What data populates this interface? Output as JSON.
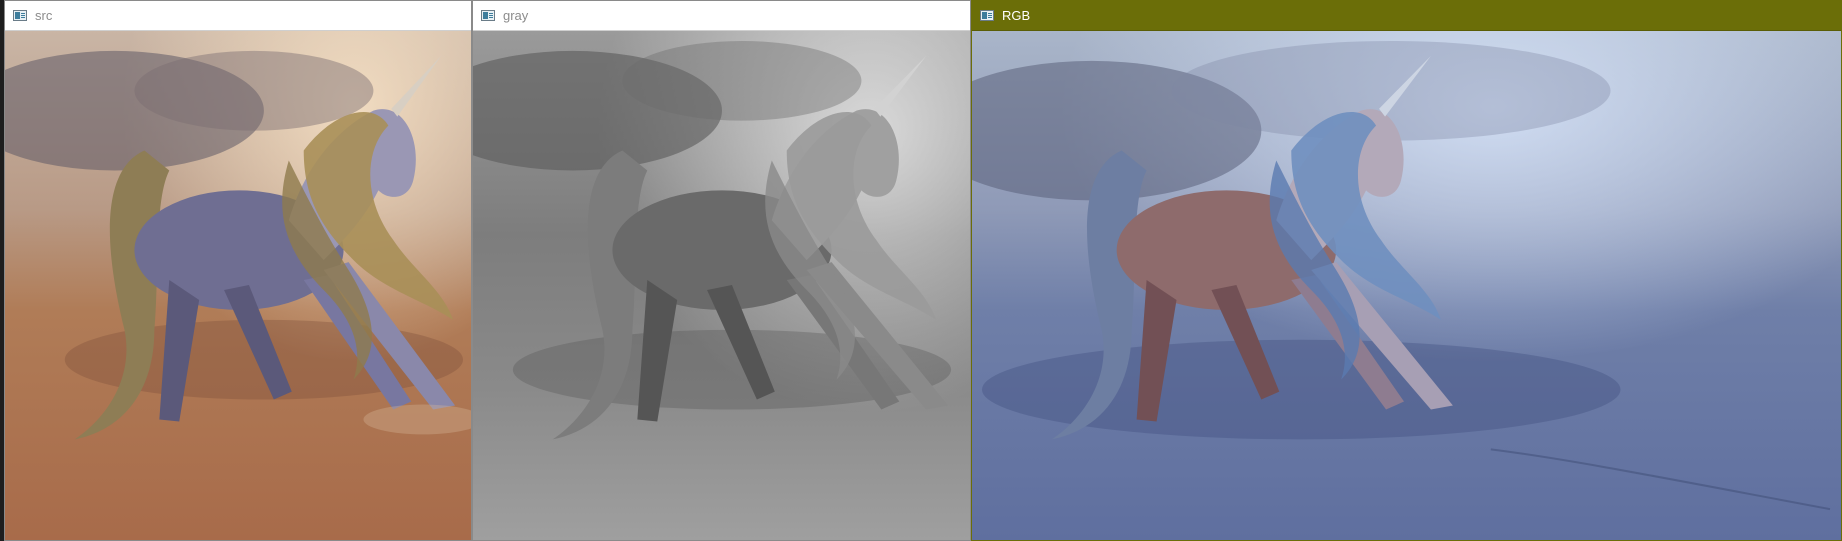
{
  "windows": [
    {
      "id": "src",
      "title": "src",
      "active": false,
      "mode": "color"
    },
    {
      "id": "gray",
      "title": "gray",
      "active": false,
      "mode": "grayscale"
    },
    {
      "id": "rgb",
      "title": "RGB",
      "active": true,
      "mode": "channel-swapped"
    }
  ],
  "icons": {
    "window_icon": "app-window-icon"
  },
  "colors": {
    "active_title_bg": "#6b6e08",
    "inactive_title_bg": "#ffffff",
    "inactive_title_text": "#8c8c8c",
    "active_title_text": "#ffffff"
  }
}
